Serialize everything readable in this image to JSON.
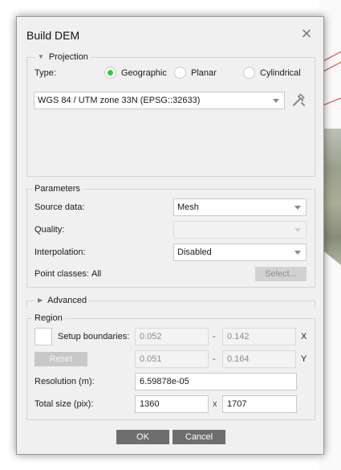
{
  "dialog": {
    "title": "Build DEM"
  },
  "projection": {
    "legend": "Projection",
    "type_label": "Type:",
    "options": [
      "Geographic",
      "Planar",
      "Cylindrical"
    ],
    "selected": "Geographic",
    "crs_value": "WGS 84 / UTM zone 33N (EPSG::32633)"
  },
  "parameters": {
    "legend": "Parameters",
    "source_label": "Source data:",
    "source_value": "Mesh",
    "quality_label": "Quality:",
    "quality_value": "",
    "interpolation_label": "Interpolation:",
    "interpolation_value": "Disabled",
    "point_classes_label": "Point classes:",
    "point_classes_value": "All",
    "select_button": "Select..."
  },
  "advanced": {
    "legend": "Advanced"
  },
  "region": {
    "legend": "Region",
    "setup_boundaries_label": "Setup boundaries:",
    "x_min": "0.052",
    "x_max": "0.142",
    "x_label": "X",
    "y_min": "0.051",
    "y_max": "0.164",
    "y_label": "Y",
    "dash": "-",
    "reset_button": "Reset",
    "resolution_label": "Resolution (m):",
    "resolution_value": "6.59878e-05",
    "total_size_label": "Total size (pix):",
    "width_value": "1360",
    "times": "x",
    "height_value": "1707"
  },
  "buttons": {
    "ok": "OK",
    "cancel": "Cancel"
  },
  "colors": {
    "radio_selected": "#2ecc40",
    "button_bg": "#6e6e6e",
    "dialog_bg": "#f0f0f0"
  }
}
